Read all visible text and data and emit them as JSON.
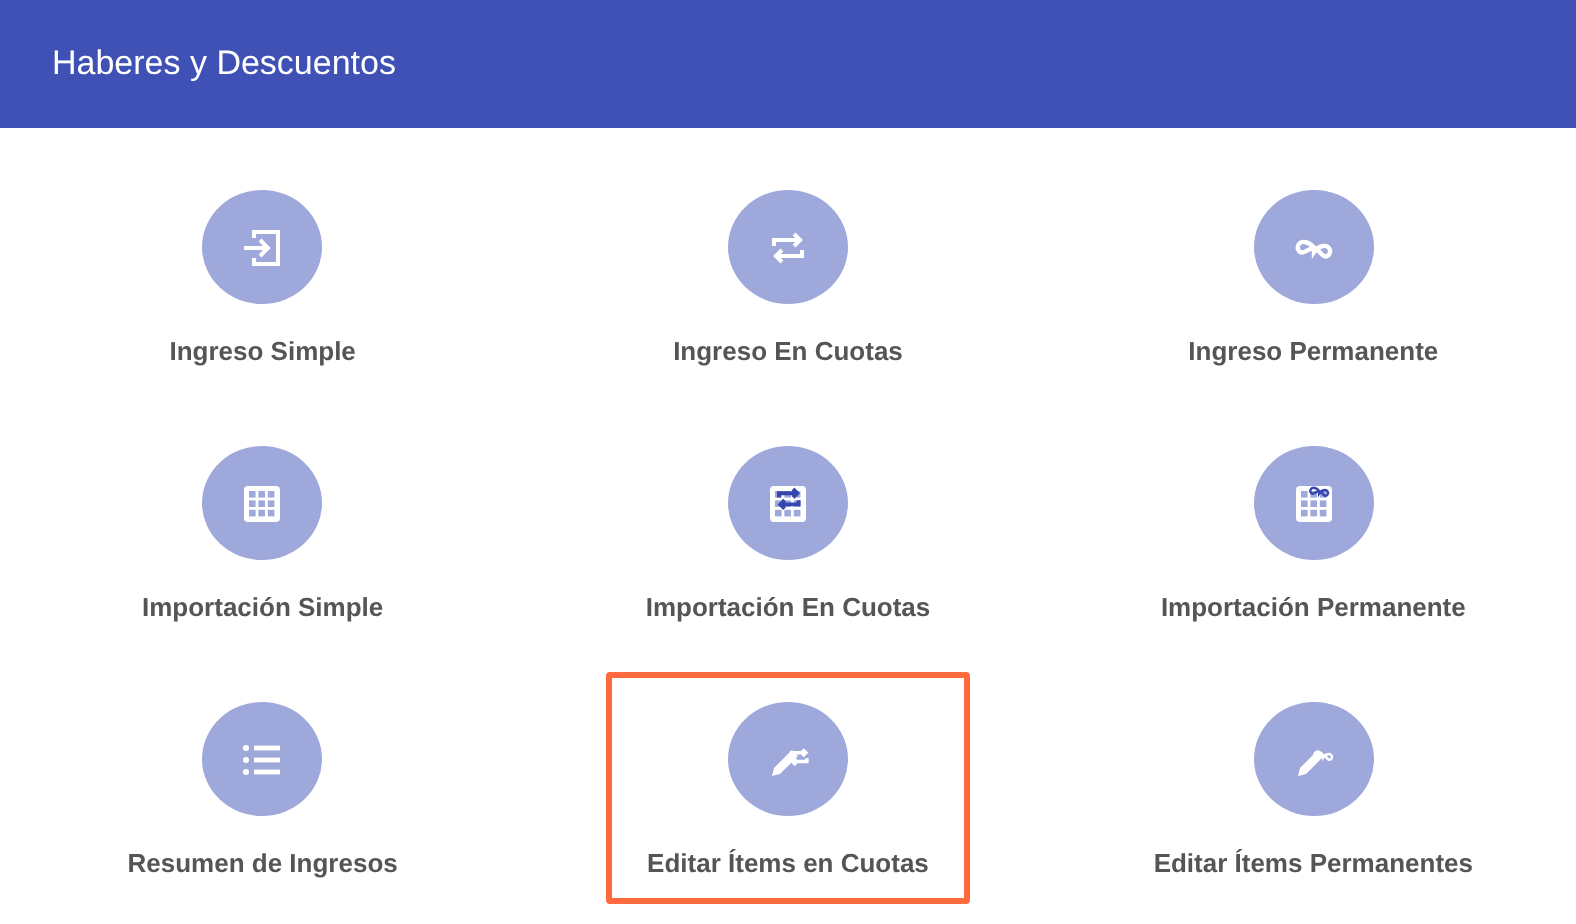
{
  "header": {
    "title": "Haberes y Descuentos"
  },
  "items": [
    {
      "label": "Ingreso Simple",
      "kind": "enter",
      "selected": false
    },
    {
      "label": "Ingreso En Cuotas",
      "kind": "repeat",
      "selected": false
    },
    {
      "label": "Ingreso Permanente",
      "kind": "infinity",
      "selected": false
    },
    {
      "label": "Importación Simple",
      "kind": "grid",
      "selected": false
    },
    {
      "label": "Importación En Cuotas",
      "kind": "grid-repeat",
      "selected": false
    },
    {
      "label": "Importación Permanente",
      "kind": "grid-infinity",
      "selected": false
    },
    {
      "label": "Resumen de Ingresos",
      "kind": "list",
      "selected": false
    },
    {
      "label": "Editar Ítems en Cuotas",
      "kind": "pencil-repeat",
      "selected": true
    },
    {
      "label": "Editar Ítems Permanentes",
      "kind": "pencil-infinity",
      "selected": false
    }
  ]
}
